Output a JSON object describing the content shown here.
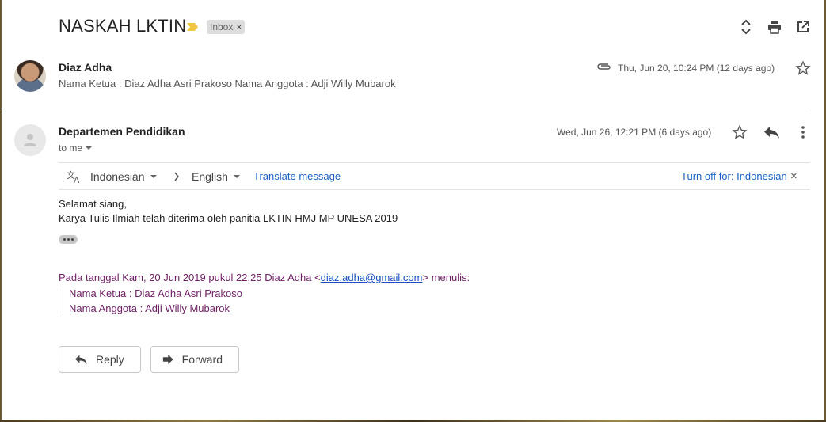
{
  "thread": {
    "subject": "NASKAH LKTIN",
    "label": "Inbox",
    "label_close": "×"
  },
  "messages": [
    {
      "sender": "Diaz Adha",
      "snippet": "Nama Ketua : Diaz Adha Asri Prakoso Nama Anggota : Adji Willy Mubarok",
      "date": "Thu, Jun 20, 10:24 PM (12 days ago)"
    },
    {
      "sender": "Departemen Pendidikan",
      "recipient": "to me",
      "date": "Wed, Jun 26, 12:21 PM (6 days ago)",
      "translate": {
        "from_lang": "Indonesian",
        "to_lang": "English",
        "translate_link": "Translate message",
        "turn_off": "Turn off for: Indonesian",
        "close": "×"
      },
      "body": {
        "line1": "Selamat siang,",
        "line2": "Karya Tulis Ilmiah telah diterima oleh panitia LKTIN HMJ MP UNESA 2019"
      },
      "quote": {
        "header_prefix": "Pada tanggal Kam, 20 Jun 2019 pukul 22.25 Diaz Adha <",
        "email": "diaz.adha@gmail.com",
        "header_suffix": "> menulis:",
        "line1": "Nama Ketua : Diaz Adha Asri Prakoso",
        "line2": "Nama Anggota : Adji Willy Mubarok"
      }
    }
  ],
  "actions": {
    "reply_label": "Reply",
    "forward_label": "Forward"
  },
  "icons": {
    "importance": "importance-marker-icon",
    "expand": "expand-collapse-icon",
    "print": "print-icon",
    "new_window": "open-in-new-window-icon",
    "attachment": "paperclip-icon",
    "star": "star-icon",
    "reply": "reply-icon",
    "more": "more-vert-icon",
    "translate": "translate-icon",
    "forward": "forward-icon"
  },
  "colors": {
    "link": "#1a62c6",
    "quote_text": "#6e1f64",
    "importance": "#f4c542"
  }
}
